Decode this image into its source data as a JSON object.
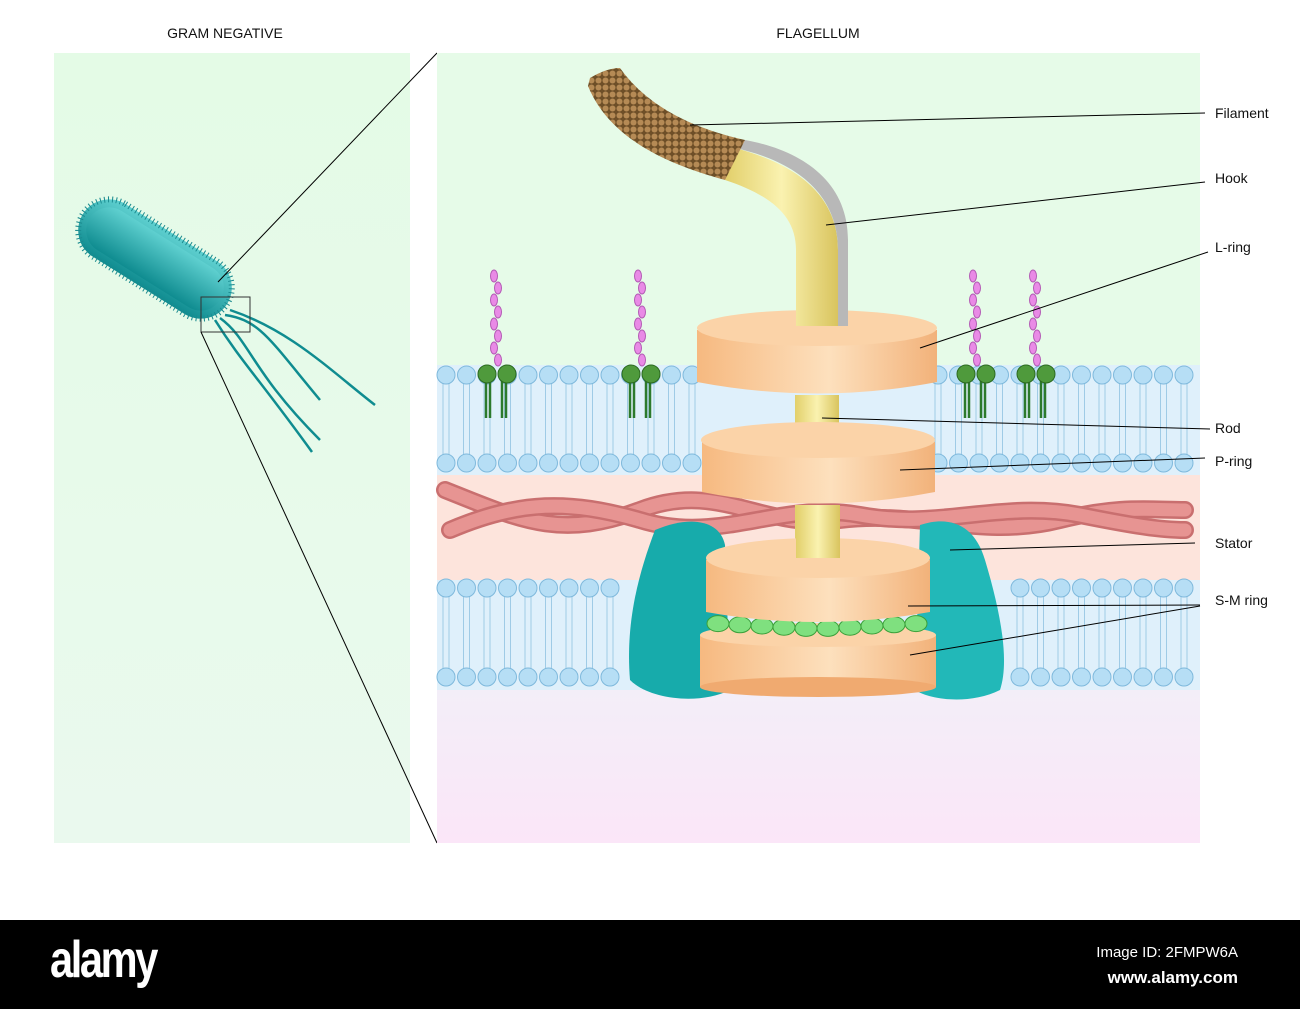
{
  "titles": {
    "left": "GRAM NEGATIVE",
    "right": "FLAGELLUM"
  },
  "labels": [
    "Filament",
    "Hook",
    "L-ring",
    "Rod",
    "P-ring",
    "Stator",
    "S-M ring"
  ],
  "footer": {
    "logo": "alamy",
    "image_id": "Image ID: 2FMPW6A",
    "site": "www.alamy.com"
  },
  "colors": {
    "panel": "#e6fbe8",
    "membrane": "#dff0fb",
    "lipid_head": "#b6def5",
    "peptidoglycan": "#fde4dc",
    "ring": "#f8c58c",
    "stator": "#1fb5b5",
    "rod": "#f0e08a",
    "filament": "#8a6a3a"
  }
}
